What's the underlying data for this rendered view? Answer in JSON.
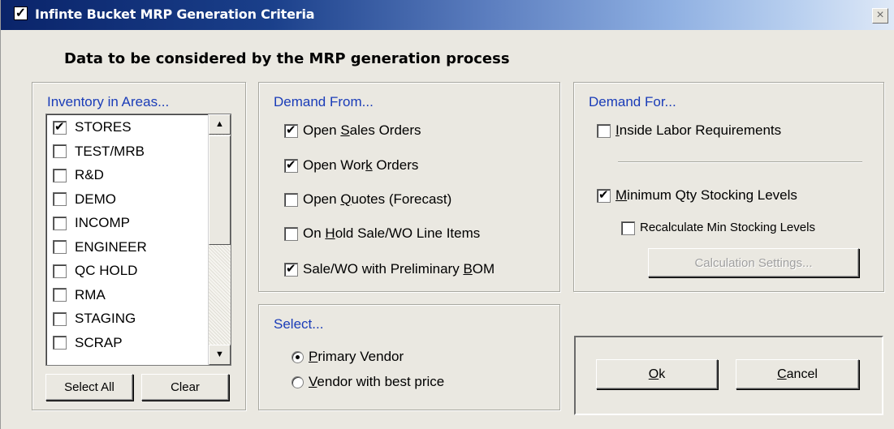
{
  "window": {
    "title": "Infinte Bucket MRP Generation Criteria",
    "close_label": "×",
    "title_checked": true
  },
  "heading": "Data to be considered by the MRP generation process",
  "inventory": {
    "title": "Inventory in Areas...",
    "items": [
      {
        "label": "STORES",
        "checked": true
      },
      {
        "label": "TEST/MRB",
        "checked": false
      },
      {
        "label": "R&D",
        "checked": false
      },
      {
        "label": "DEMO",
        "checked": false
      },
      {
        "label": "INCOMP",
        "checked": false
      },
      {
        "label": "ENGINEER",
        "checked": false
      },
      {
        "label": "QC HOLD",
        "checked": false
      },
      {
        "label": "RMA",
        "checked": false
      },
      {
        "label": "STAGING",
        "checked": false
      },
      {
        "label": "SCRAP",
        "checked": false
      }
    ],
    "select_all_label": "Select All",
    "clear_label": "Clear"
  },
  "demand_from": {
    "title": "Demand From...",
    "items": [
      {
        "pre": "Open ",
        "key": "S",
        "post": "ales Orders",
        "checked": true
      },
      {
        "pre": "Open Wor",
        "key": "k",
        "post": " Orders",
        "checked": true
      },
      {
        "pre": "Open ",
        "key": "Q",
        "post": "uotes (Forecast)",
        "checked": false
      },
      {
        "pre": "On ",
        "key": "H",
        "post": "old Sale/WO Line Items",
        "checked": false
      },
      {
        "pre": "Sale/WO with Preliminary ",
        "key": "B",
        "post": "OM",
        "checked": true
      }
    ]
  },
  "demand_for": {
    "title": "Demand For...",
    "inside_labor": {
      "pre": "",
      "key": "I",
      "post": "nside Labor Requirements",
      "checked": false
    },
    "min_qty": {
      "pre": "",
      "key": "M",
      "post": "inimum Qty Stocking Levels",
      "checked": true
    },
    "recalc_label": "Recalculate Min Stocking Levels",
    "recalc_checked": false,
    "calc_settings_label": "Calculation Settings..."
  },
  "select": {
    "title": "Select...",
    "options": [
      {
        "pre": "",
        "key": "P",
        "post": "rimary Vendor",
        "selected": true
      },
      {
        "pre": "",
        "key": "V",
        "post": "endor with best price",
        "selected": false
      }
    ]
  },
  "actions": {
    "ok": {
      "key": "O",
      "post": "k"
    },
    "cancel": {
      "key": "C",
      "post": "ancel"
    }
  },
  "colors": {
    "group_title": "#1a3cb8",
    "titlebar_start": "#0a246a",
    "titlebar_end": "#dfe9f7",
    "dialog_bg": "#eae8e1"
  }
}
